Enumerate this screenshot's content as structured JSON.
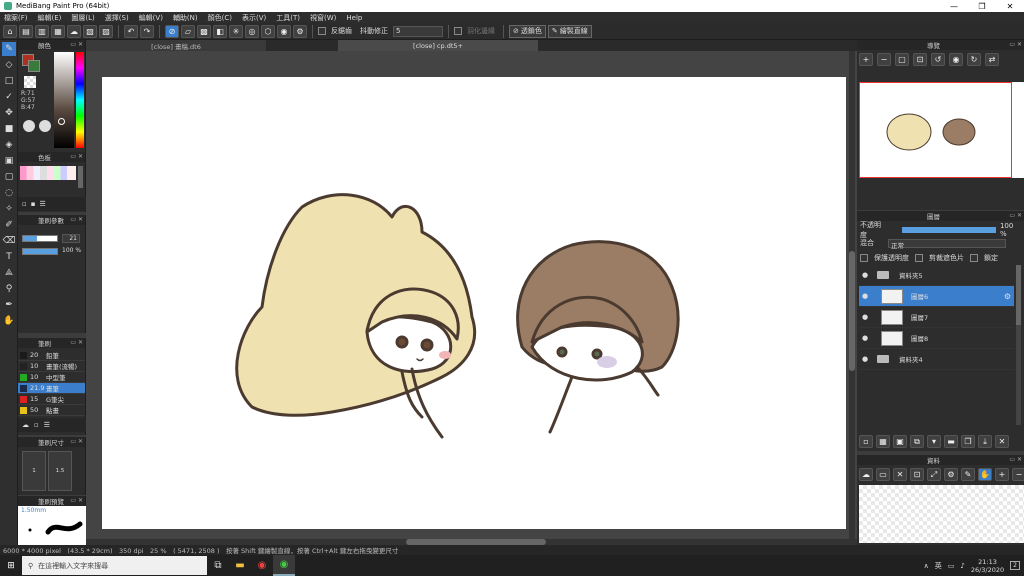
{
  "window": {
    "title": "MediBang Paint Pro (64bit)",
    "minimize": "—",
    "maximize": "❐",
    "close": "✕"
  },
  "menu": [
    "檔案(F)",
    "編輯(E)",
    "圖層(L)",
    "選擇(S)",
    "編輯(V)",
    "輔助(N)",
    "顏色(C)",
    "表示(V)",
    "工具(T)",
    "視窗(W)",
    "Help"
  ],
  "toolbar": {
    "antialias_label": "反鋸齒",
    "correction_label": "抖動修正",
    "correction_value": "5",
    "soft_edge_label": "羽化邊緣",
    "transparency_protect_label": "透鎖色",
    "draw_line_label": "繪製直線"
  },
  "tabs": [
    "[close] 畫稿.dt6",
    "[close] cp.dt5+"
  ],
  "color_panel": {
    "title": "顏色",
    "readout": [
      "R:71",
      "G:57",
      "B:47"
    ]
  },
  "palette_panel": {
    "title": "色板"
  },
  "brush_params": {
    "title": "筆刷參數",
    "size_value": "21",
    "opacity_value": "100 %"
  },
  "brush_panel": {
    "title": "筆刷",
    "items": [
      {
        "size": "20",
        "name": "鉛筆",
        "color": "#1a1a1a"
      },
      {
        "size": "10",
        "name": "畫筆(流暢)",
        "color": "#222222"
      },
      {
        "size": "10",
        "name": "中型筆",
        "color": "#22aa22"
      },
      {
        "size": "21.9",
        "name": "畫筆",
        "color": "#1b2a4a"
      },
      {
        "size": "15",
        "name": "G筆尖",
        "color": "#dd2222"
      },
      {
        "size": "50",
        "name": "點畫",
        "color": "#e8c21b"
      }
    ]
  },
  "brush_size_panel": {
    "title": "筆刷尺寸",
    "cells": [
      "1",
      "1.5"
    ]
  },
  "brush_preview_panel": {
    "title": "筆刷預覽",
    "size": "1.50mm"
  },
  "navigator": {
    "title": "導覽"
  },
  "layers": {
    "title": "圖層",
    "opacity_label": "不透明度",
    "opacity_value": "100 %",
    "blend_label": "混合",
    "blend_value": "正常",
    "protect_alpha": "保護透明度",
    "clipping": "剪裁遮色片",
    "lock": "鎖定",
    "rows": [
      {
        "name": "資料夾5",
        "type": "folder",
        "selected": false
      },
      {
        "name": "圖層6",
        "type": "layer",
        "selected": true
      },
      {
        "name": "圖層7",
        "type": "layer",
        "selected": false
      },
      {
        "name": "圖層8",
        "type": "layer",
        "selected": false
      },
      {
        "name": "資料夾4",
        "type": "folder",
        "selected": false
      }
    ]
  },
  "materials": {
    "title": "資料"
  },
  "status": "6000 * 4000 pixel　(43.5 * 29cm)　350 dpi　25 %　( 5471, 2508 )　按著 Shift 鍵繪製直線，按著 Ctrl+Alt 鍵左右拖曳變更尺寸",
  "taskbar": {
    "search_placeholder": "在這裡輸入文字來搜尋",
    "ime": "英",
    "time": "21:13",
    "date": "26/3/2020",
    "notif": "2"
  },
  "colors": {
    "accent": "#3b7fcc",
    "hair_blonde": "#efe2b0",
    "hair_brown": "#9a7d64",
    "line": "#4a3a30"
  }
}
